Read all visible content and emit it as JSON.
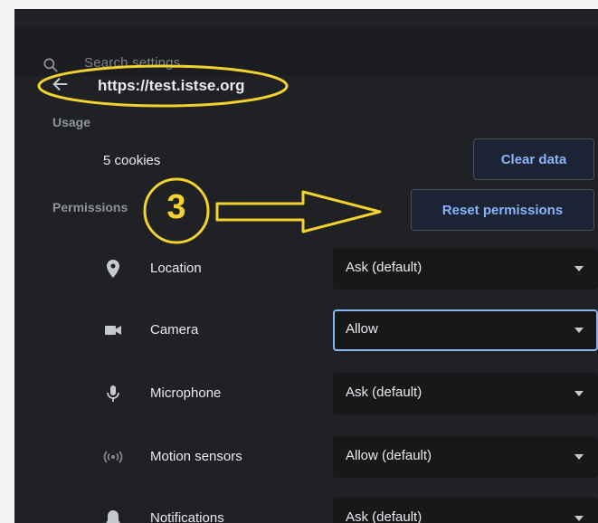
{
  "search": {
    "placeholder": "Search settings",
    "icon": "search-icon"
  },
  "site": {
    "url": "https://test.istse.org",
    "back_icon": "arrow-back-icon"
  },
  "usage": {
    "section_label": "Usage",
    "cookies": "5 cookies",
    "clear_button": "Clear data"
  },
  "permissions": {
    "section_label": "Permissions",
    "reset_button": "Reset permissions",
    "items": [
      {
        "label": "Location",
        "value": "Ask (default)",
        "icon": "location-pin-icon"
      },
      {
        "label": "Camera",
        "value": "Allow",
        "icon": "camera-icon"
      },
      {
        "label": "Microphone",
        "value": "Ask (default)",
        "icon": "microphone-icon"
      },
      {
        "label": "Motion sensors",
        "value": "Allow (default)",
        "icon": "motion-sensors-icon"
      },
      {
        "label": "Notifications",
        "value": "Ask (default)",
        "icon": "bell-icon"
      }
    ]
  },
  "annotation": {
    "step_number": "3",
    "color": "#f2d22e"
  },
  "colors": {
    "background": "#202124",
    "text": "#e8eaed",
    "accent": "#8ab4f8",
    "muted": "#8f949a"
  }
}
